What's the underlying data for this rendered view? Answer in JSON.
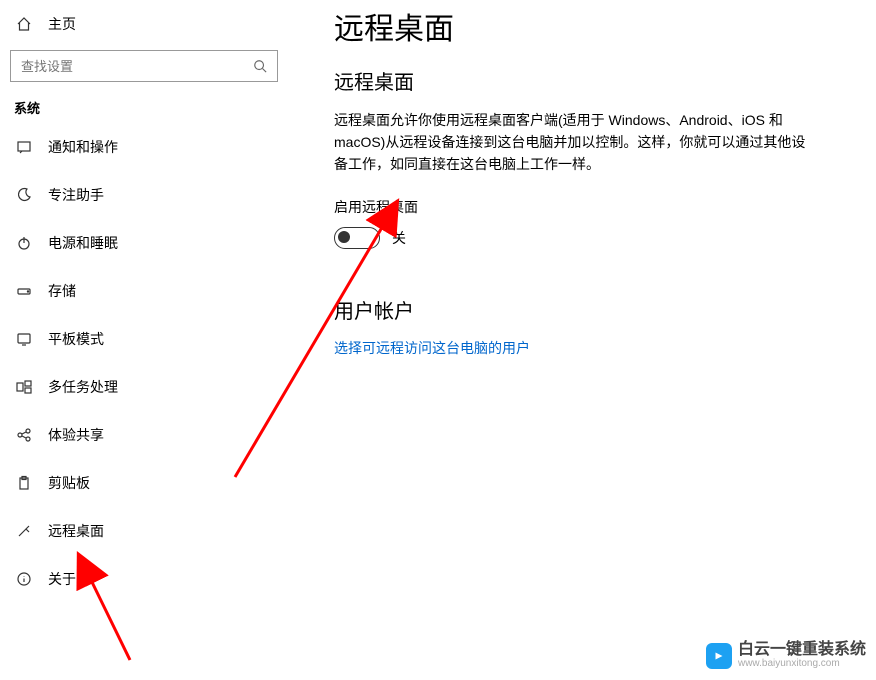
{
  "header": {
    "home_label": "主页"
  },
  "search": {
    "placeholder": "查找设置"
  },
  "sidebar": {
    "category": "系统",
    "items": [
      {
        "label": "通知和操作"
      },
      {
        "label": "专注助手"
      },
      {
        "label": "电源和睡眠"
      },
      {
        "label": "存储"
      },
      {
        "label": "平板模式"
      },
      {
        "label": "多任务处理"
      },
      {
        "label": "体验共享"
      },
      {
        "label": "剪贴板"
      },
      {
        "label": "远程桌面"
      },
      {
        "label": "关于"
      }
    ]
  },
  "main": {
    "title": "远程桌面",
    "section1_title": "远程桌面",
    "description": "远程桌面允许你使用远程桌面客户端(适用于 Windows、Android、iOS 和 macOS)从远程设备连接到这台电脑并加以控制。这样，你就可以通过其他设备工作，如同直接在这台电脑上工作一样。",
    "toggle_label": "启用远程桌面",
    "toggle_state": "关",
    "section2_title": "用户帐户",
    "link_text": "选择可远程访问这台电脑的用户"
  },
  "watermark": {
    "line1": "白云一键重装系统",
    "line2": "www.baiyunxitong.com"
  }
}
